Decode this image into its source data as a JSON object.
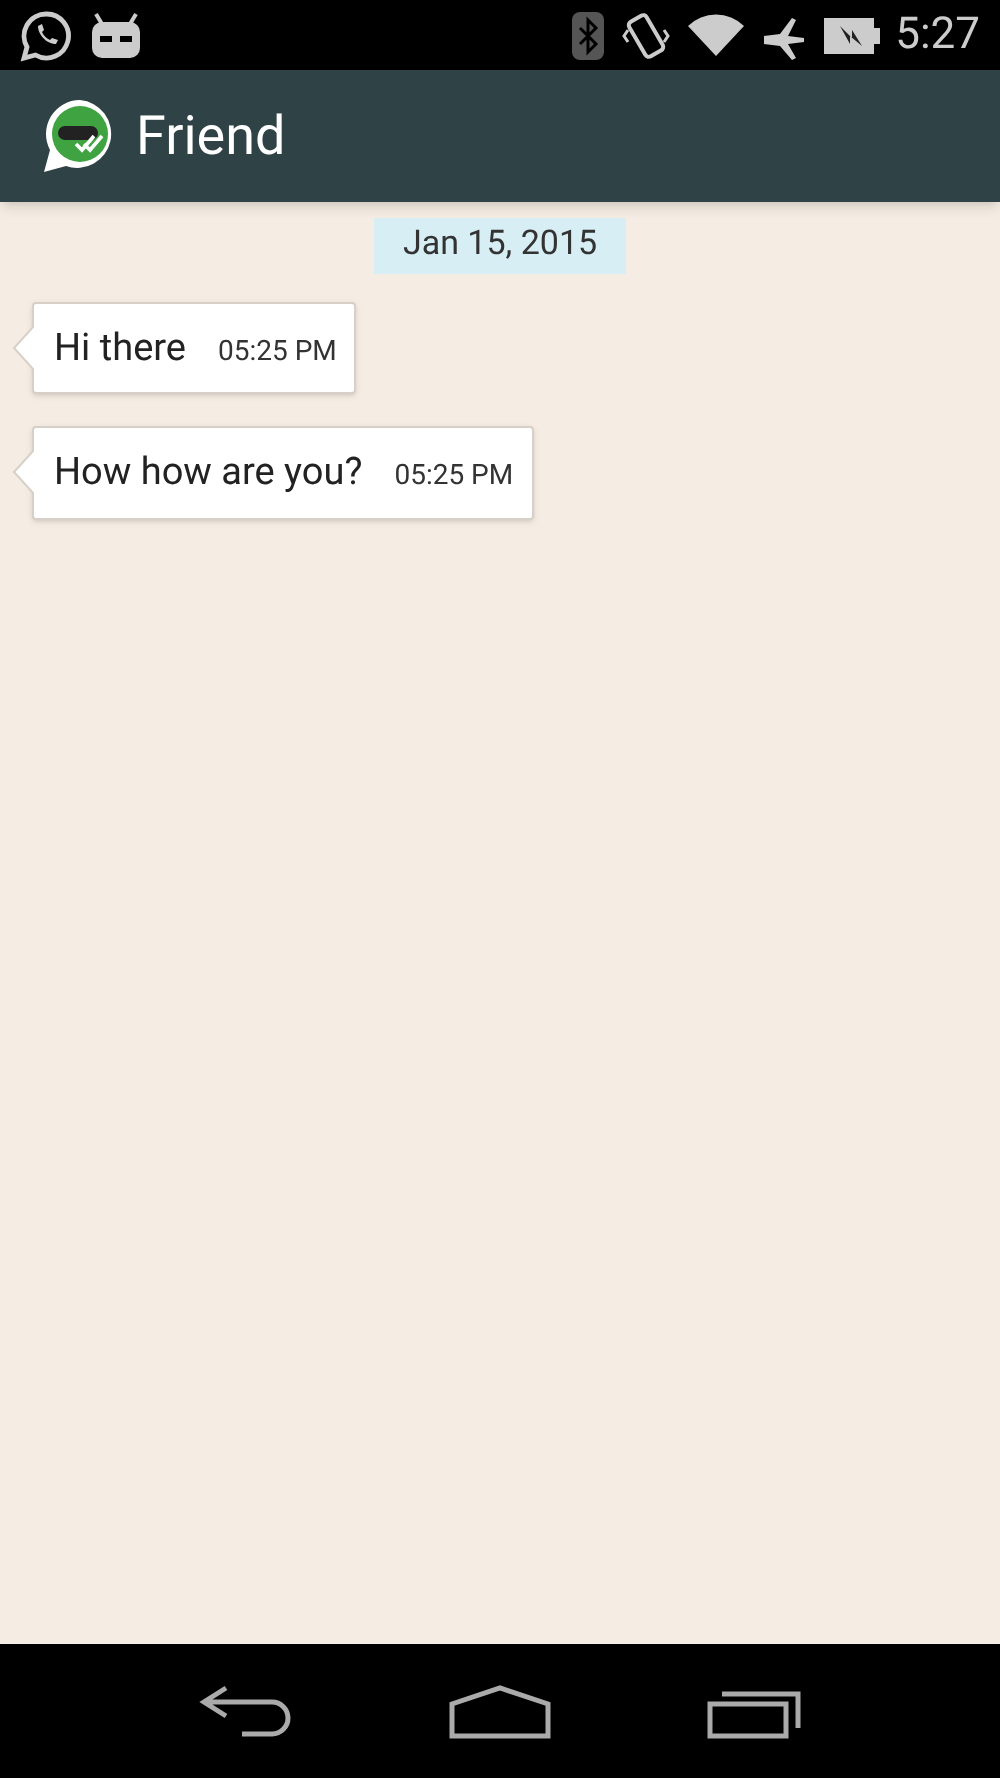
{
  "status_bar": {
    "time": "5:27"
  },
  "app_bar": {
    "title": "Friend"
  },
  "date_divider": "Jan 15, 2015",
  "messages": [
    {
      "text": "Hi there",
      "time": "05:25 PM"
    },
    {
      "text": "How how are you?",
      "time": "05:25 PM"
    }
  ]
}
